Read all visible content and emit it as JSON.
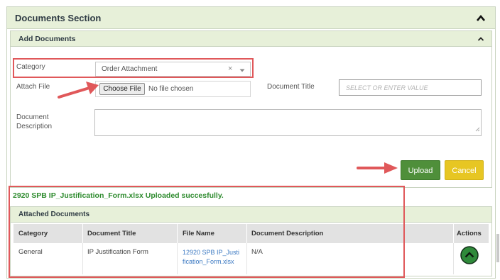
{
  "documents_section": {
    "title": "Documents Section"
  },
  "add_documents": {
    "title": "Add Documents",
    "category_label": "Category",
    "category_value": "Order Attachment",
    "category_clear": "×",
    "attach_file_label": "Attach File",
    "choose_file_label": "Choose File",
    "no_file_text": "No file chosen",
    "document_title_label": "Document Title",
    "document_title_placeholder": "SELECT OR ENTER VALUE",
    "document_description_label_1": "Document",
    "document_description_label_2": "Description",
    "upload_label": "Upload",
    "cancel_label": "Cancel"
  },
  "success_message": "2920 SPB IP_Justification_Form.xlsx Uploaded succesfully.",
  "attached_documents": {
    "title": "Attached Documents",
    "columns": [
      "Category",
      "Document Title",
      "File Name",
      "Document Description",
      "Actions"
    ],
    "rows": [
      {
        "category": "General",
        "document_title": "IP Justification Form",
        "file_name_line1": "12920 SPB IP_Justi",
        "file_name_line2": "fication_Form.xlsx",
        "description": "N/A"
      }
    ]
  },
  "colors": {
    "header_bg": "#e7f0d9",
    "upload_green": "#4f8f3a",
    "cancel_yellow": "#e7c623",
    "success_green": "#2e8b2e",
    "link_blue": "#3a78c2",
    "highlight_red": "#e0585a"
  }
}
